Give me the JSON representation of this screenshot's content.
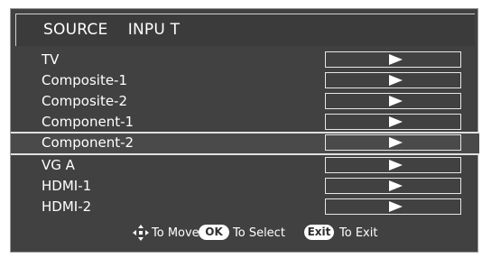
{
  "menu": {
    "title": "SOURCE    INPU T",
    "items": [
      {
        "label": "TV"
      },
      {
        "label": "Composite-1"
      },
      {
        "label": "Composite-2"
      },
      {
        "label": "Component-1"
      },
      {
        "label": "Component-2"
      },
      {
        "label": "VG A"
      },
      {
        "label": "HDMI-1"
      },
      {
        "label": "HDMI-2"
      }
    ],
    "selected_index": 4
  },
  "footer": {
    "move_text": "To Move",
    "ok_key": "OK",
    "select_text": "To Select",
    "exit_key": "Exit",
    "exit_text": "To Exit"
  },
  "icons": {
    "move": "dpad-arrows-icon",
    "slot_arrow": "play-arrow-icon"
  },
  "colors": {
    "panel": "#414141",
    "text": "#ffffff",
    "highlight_line": "#e0e0e0"
  }
}
